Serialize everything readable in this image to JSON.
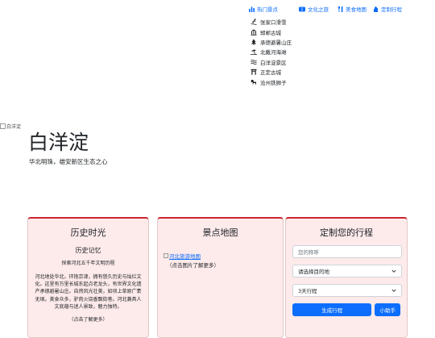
{
  "nav": {
    "hot_spots": "热门景点",
    "culture": "文化之旅",
    "food_map": "美食地图",
    "custom_trip": "定制行程"
  },
  "dropdown": [
    {
      "label": "张家口滑雪",
      "icon": "skier-icon"
    },
    {
      "label": "邯郸古城",
      "icon": "bank-icon"
    },
    {
      "label": "承德避暑山庄",
      "icon": "trees-icon"
    },
    {
      "label": "北戴河海滩",
      "icon": "beach-icon"
    },
    {
      "label": "白洋淀景区",
      "icon": "water-icon"
    },
    {
      "label": "正定古城",
      "icon": "gate-icon"
    },
    {
      "label": "沧州铁狮子",
      "icon": "lion-icon"
    }
  ],
  "hero": {
    "img_alt": "白洋淀",
    "title": "白洋淀",
    "subtitle": "华北明珠，雄安新区生态之心"
  },
  "history": {
    "title": "历史时光",
    "subtitle": "历史记忆",
    "tagline": "探索河北五千年文明历程",
    "body": "河北地处华北，环抱京津，拥有悠久历史与灿烂文化。这里有万里长城东起点老龙头，有世界文化遗产承德避暑山庄。自然风光壮美，如坝上草原广袤无垠。美食众多，驴肉火烧香飘街巷。河北兼具人文底蕴与迷人景致，魅力独特。",
    "more": "（点击了解更多）"
  },
  "map": {
    "title": "景点地图",
    "link": "河北旅游地图",
    "hint": "（点击图片了解更多）"
  },
  "trip": {
    "title": "定制您的行程",
    "name_placeholder": "您的称呼",
    "destination": "请选择目的地",
    "duration": "3天行程",
    "generate": "生成行程",
    "helper": "小助手"
  },
  "colors": {
    "primary": "#0d6efd",
    "card_bg": "#fdeaea",
    "card_accent": "#c9252e"
  }
}
